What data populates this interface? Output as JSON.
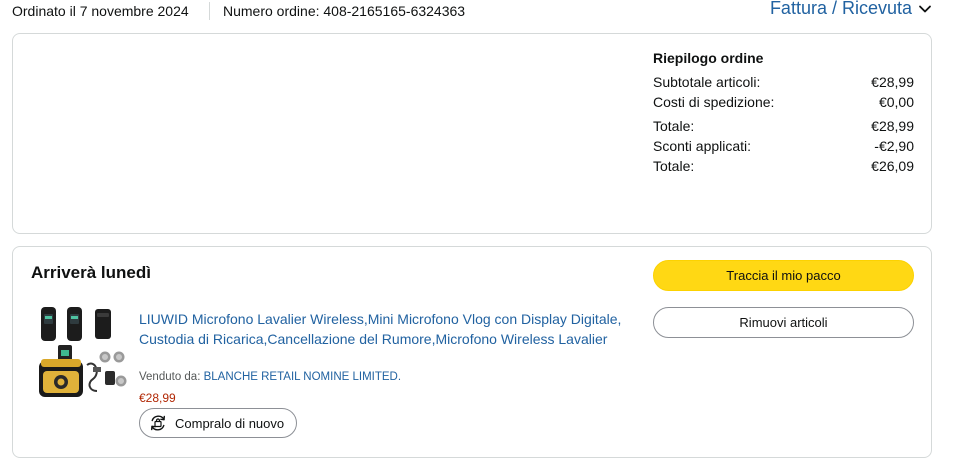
{
  "header": {
    "order_date": "Ordinato il 7 novembre 2024",
    "order_number": "Numero ordine: 408-2165165-6324363",
    "invoice_link": "Fattura / Ricevuta"
  },
  "summary": {
    "title": "Riepilogo ordine",
    "rows": [
      {
        "label": "Subtotale articoli:",
        "value": "€28,99"
      },
      {
        "label": "Costi di spedizione:",
        "value": "€0,00"
      },
      {
        "label": "Totale:",
        "value": "€28,99"
      },
      {
        "label": "Sconti applicati:",
        "value": "-€2,90"
      },
      {
        "label": "Totale:",
        "value": "€26,09"
      }
    ]
  },
  "shipment": {
    "status": "Arriverà lunedì",
    "track_button": "Traccia il mio pacco",
    "remove_button": "Rimuovi articoli",
    "product": {
      "title": "LIUWID Microfono Lavalier Wireless,Mini Microfono Vlog con Display Digitale, Custodia di Ricarica,Cancellazione del Rumore,Microfono Wireless Lavalier",
      "sold_by_label": "Venduto da:",
      "seller": "BLANCHE RETAIL NOMINE LIMITED.",
      "price": "€28,99",
      "buy_again": "Compralo di nuovo"
    }
  },
  "icons": {
    "invoice_dropdown": "chevron-down-icon",
    "buy_again": "rebuy-icon"
  },
  "colors": {
    "link": "#2162a1",
    "price": "#b12704",
    "track_button": "#ffd814",
    "border": "#d5d9d9"
  }
}
